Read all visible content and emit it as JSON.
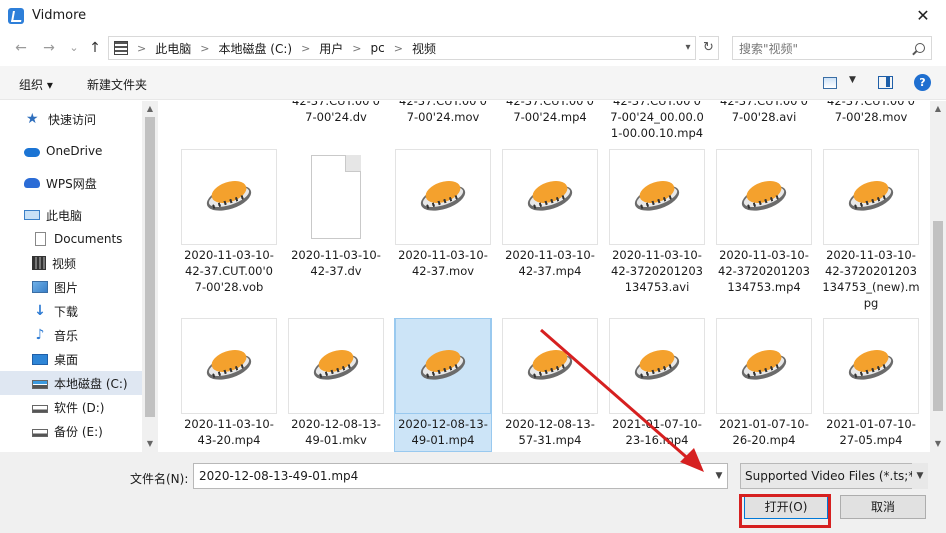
{
  "window": {
    "title": "Vidmore",
    "close_label": "✕"
  },
  "nav": {
    "back": "←",
    "forward": "→",
    "recent": "⌄",
    "up": "↑"
  },
  "breadcrumb": {
    "items": [
      "此电脑",
      "本地磁盘 (C:)",
      "用户",
      "pc",
      "视频"
    ],
    "separator": ">"
  },
  "search": {
    "placeholder": "搜索\"视频\""
  },
  "toolbar": {
    "organize_label": "组织 ▾",
    "new_folder_label": "新建文件夹",
    "help_label": "?"
  },
  "sidebar": {
    "items": [
      {
        "label": "快速访问"
      },
      {
        "label": "OneDrive"
      },
      {
        "label": "WPS网盘"
      },
      {
        "label": "此电脑"
      },
      {
        "label": "Documents"
      },
      {
        "label": "视频"
      },
      {
        "label": "图片"
      },
      {
        "label": "下载"
      },
      {
        "label": "音乐"
      },
      {
        "label": "桌面"
      },
      {
        "label": "本地磁盘 (C:)"
      },
      {
        "label": "软件 (D:)"
      },
      {
        "label": "备份 (E:)"
      }
    ]
  },
  "files": {
    "top_row": [
      "42-37.CUT.00'0\n7-00'24.dv",
      "42-37.CUT.00'0\n7-00'24.mov",
      "42-37.CUT.00'0\n7-00'24.mp4",
      "42-37.CUT.00'0\n7-00'24_00.00.0\n1-00.00.10.mp4",
      "42-37.CUT.00'0\n7-00'28.avi",
      "42-37.CUT.00'0\n7-00'28.mov"
    ],
    "row2": [
      "2020-11-03-10-\n42-37.CUT.00'0\n7-00'28.vob",
      "2020-11-03-10-\n42-37.dv",
      "2020-11-03-10-\n42-37.mov",
      "2020-11-03-10-\n42-37.mp4",
      "2020-11-03-10-\n42-3720201203\n134753.avi",
      "2020-11-03-10-\n42-3720201203\n134753.mp4",
      "2020-11-03-10-\n42-3720201203\n134753_(new).m\npg"
    ],
    "row3": [
      "2020-11-03-10-\n43-20.mp4",
      "2020-12-08-13-\n49-01.mkv",
      "2020-12-08-13-\n49-01.mp4",
      "2020-12-08-13-\n57-31.mp4",
      "2021-01-07-10-\n23-16.mp4",
      "2021-01-07-10-\n26-20.mp4",
      "2021-01-07-10-\n27-05.mp4"
    ]
  },
  "bottom": {
    "filename_label": "文件名(N):",
    "filename_value": "2020-12-08-13-49-01.mp4",
    "filetype_value": "Supported Video Files (*.ts;*",
    "open_label": "打开(O)",
    "cancel_label": "取消"
  },
  "colors": {
    "accent": "#0078d7",
    "annotation": "#d62020",
    "selection": "#cce4f7"
  }
}
